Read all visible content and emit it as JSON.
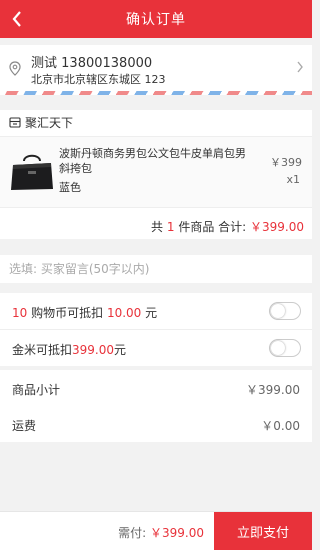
{
  "header": {
    "title": "确认订单"
  },
  "address": {
    "name": "测试",
    "phone": "13800138000",
    "full": "北京市北京辖区东城区 123"
  },
  "shop": {
    "name": "聚汇天下",
    "item": {
      "name": "波斯丹顿商务男包公文包牛皮单肩包男斜挎包",
      "color": "蓝色",
      "price": "￥399",
      "qty": "x1"
    },
    "summary": {
      "prefix": "共",
      "count": "1",
      "middle": "件商品 合计:",
      "total": "￥399.00"
    }
  },
  "remark": {
    "placeholder": "选填: 买家留言(50字以内)"
  },
  "deduct": {
    "coins": {
      "count": "10",
      "text": "购物币可抵扣",
      "amount": "10.00",
      "unit": "元"
    },
    "gold": {
      "text": "金米可抵扣",
      "amount": "399.00",
      "unit": "元"
    }
  },
  "totals": {
    "subtotal_label": "商品小计",
    "subtotal": "￥399.00",
    "shipping_label": "运费",
    "shipping": "￥0.00"
  },
  "footer": {
    "due_label": "需付:",
    "due": "￥399.00",
    "pay_label": "立即支付"
  },
  "colors": {
    "brand": "#e8323a"
  }
}
